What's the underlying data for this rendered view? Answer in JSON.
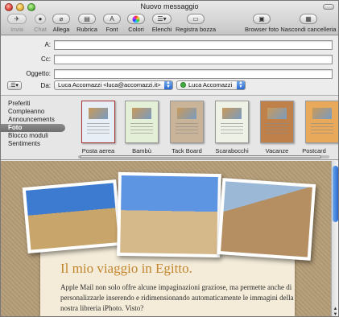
{
  "window": {
    "title": "Nuovo messaggio"
  },
  "toolbar": {
    "items": [
      {
        "label": "Invia",
        "icon": "send-icon",
        "disabled": true
      },
      {
        "label": "Chat",
        "icon": "chat-icon",
        "disabled": true
      },
      {
        "label": "Allega",
        "icon": "paperclip-icon"
      },
      {
        "label": "Rubrica",
        "icon": "address-book-icon"
      },
      {
        "label": "Font",
        "icon": "font-icon"
      },
      {
        "label": "Colori",
        "icon": "color-wheel-icon"
      },
      {
        "label": "Elenchi",
        "icon": "list-icon"
      },
      {
        "label": "Registra bozza",
        "icon": "draft-icon"
      },
      {
        "label": "Browser foto",
        "icon": "photo-browser-icon"
      },
      {
        "label": "Nascondi cancelleria",
        "icon": "stationery-icon"
      }
    ]
  },
  "headers": {
    "to_label": "A:",
    "to_value": "",
    "cc_label": "Cc:",
    "cc_value": "",
    "subject_label": "Oggetto:",
    "subject_value": "",
    "from_label": "Da:",
    "from_value": "Luca Accomazzi <luca@accomazzi.it>",
    "signature_value": "Luca Accomazzi"
  },
  "stationery": {
    "categories": [
      "Preferiti",
      "Compleanno",
      "Announcements",
      "Foto",
      "Blocco moduli",
      "Sentiments"
    ],
    "selected_category": "Foto",
    "templates": [
      {
        "label": "Posta aerea",
        "color": "#e8eef6"
      },
      {
        "label": "Bambù",
        "color": "#e4efd8"
      },
      {
        "label": "Tack Board",
        "color": "#c9b49a"
      },
      {
        "label": "Scarabocchi",
        "color": "#eef2e6"
      },
      {
        "label": "Vacanze",
        "color": "#c0804a"
      },
      {
        "label": "Postcard",
        "color": "#e8a95a"
      }
    ]
  },
  "message": {
    "headline": "Il mio viaggio in Egitto.",
    "body": "Apple Mail non solo offre alcune impaginazioni graziose, ma permette anche di personalizzarle inserendo e ridimensionando automaticamente le immagini della nostra libreria iPhoto. Visto?",
    "headline_color": "#c1862f"
  }
}
